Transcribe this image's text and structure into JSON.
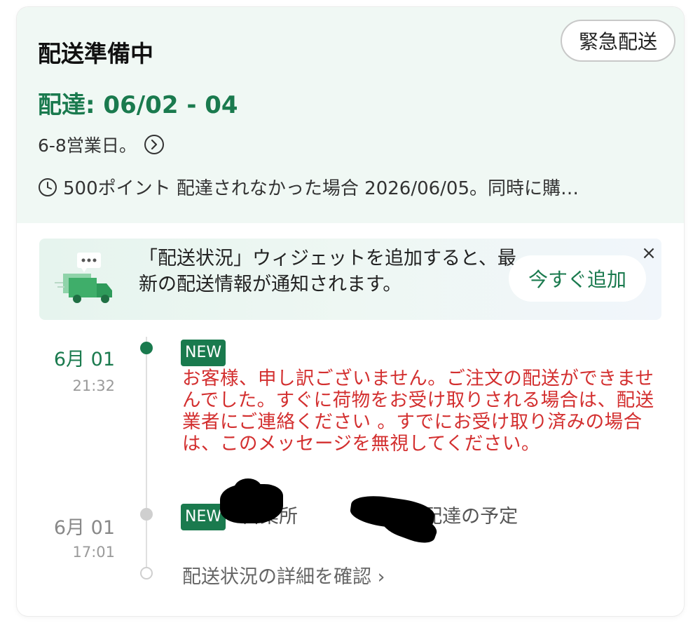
{
  "header": {
    "status_title": "配送準備中",
    "urgent_button": "緊急配送",
    "delivery_date": "配達: 06/02 - 04",
    "business_days": "6-8営業日。",
    "points_info": "500ポイント 配達されなかった場合 2026/06/05。同時に購…"
  },
  "widget_banner": {
    "text": "「配送状況」ウィジェットを追加すると、最新の配送情報が通知されます。",
    "add_button": "今すぐ追加",
    "close": "×"
  },
  "timeline": [
    {
      "date": "6月 01",
      "time": "21:32",
      "badge": "NEW",
      "message": "お客様、申し訳ございません。ご注文の配送ができませんでした。すぐに荷物をお受け取りされる場合は、配送業者にご連絡ください 。すでにお受け取り済みの場合は、このメッセージを無視してください。"
    },
    {
      "date": "6月 01",
      "time": "17:01",
      "badge": "NEW",
      "message": "営業所　　　　　　, 配達の予定"
    }
  ],
  "details_link": "配送状況の詳細を確認 ›",
  "colors": {
    "accent_green": "#1a7a4e",
    "alert_red": "#d32f2f",
    "header_bg": "#f0f8f4"
  }
}
